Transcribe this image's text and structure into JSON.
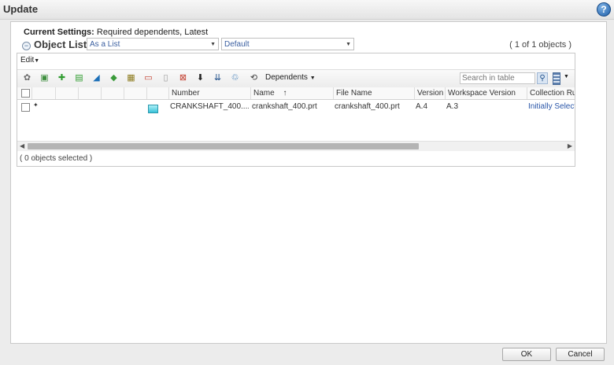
{
  "window": {
    "title": "Update",
    "help_icon": "?"
  },
  "settings": {
    "label": "Current Settings:",
    "value": "Required dependents, Latest"
  },
  "object_list": {
    "title": "Object List",
    "view_select": "As a List",
    "filter_select": "Default",
    "count": "( 1 of 1 objects )",
    "edit_menu": "Edit"
  },
  "toolbar": {
    "icons": [
      "gear-icon",
      "insert-icon",
      "add-icon",
      "remove-icon",
      "chart-icon",
      "tag-icon",
      "table-icon",
      "delete-icon",
      "copy-icon",
      "cancel-icon",
      "download-icon",
      "merge-icon",
      "recycle-icon",
      "refresh-icon"
    ],
    "dependents_label": "Dependents",
    "search_placeholder": "Search in table"
  },
  "table": {
    "columns": [
      "Number",
      "Name",
      "File Name",
      "Version",
      "Workspace Version",
      "Collection Rule"
    ],
    "sort_indicator": "↑",
    "rows": [
      {
        "number": "CRANKSHAFT_400....",
        "name": "crankshaft_400.prt",
        "file_name": "crankshaft_400.prt",
        "version": "A.4",
        "workspace_version": "A.3",
        "collection_rule": "Initially Selected"
      }
    ]
  },
  "status": {
    "selected": "( 0 objects selected )"
  },
  "buttons": {
    "ok": "OK",
    "cancel": "Cancel"
  },
  "colors": {
    "link": "#2a56a8",
    "title_bar": "#e4e4e4",
    "help": "#1f5fa8"
  }
}
